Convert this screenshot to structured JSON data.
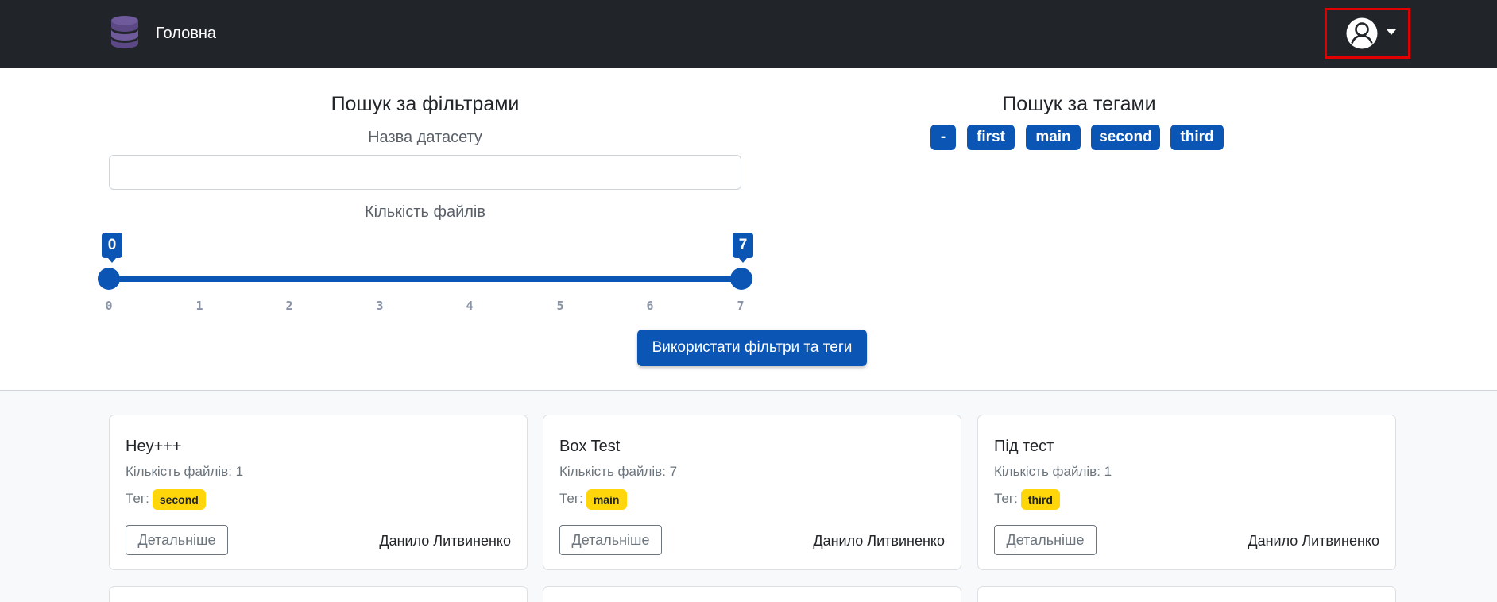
{
  "navbar": {
    "brand": "Головна",
    "logo_icon": "database-icon",
    "user_icon": "user-circle-icon"
  },
  "filters": {
    "title": "Пошук за фільтрами",
    "name_label": "Назва датасету",
    "name_value": "",
    "count_label": "Кількість файлів",
    "slider": {
      "min": 0,
      "max": 7,
      "low": 0,
      "high": 7,
      "low_label": "0",
      "high_label": "7",
      "ticks": [
        "0",
        "1",
        "2",
        "3",
        "4",
        "5",
        "6",
        "7"
      ]
    },
    "apply_label": "Використати фільтри та теги"
  },
  "tags": {
    "title": "Пошук за тегами",
    "items": [
      "-",
      "first",
      "main",
      "second",
      "third"
    ]
  },
  "datasets": [
    {
      "title": "Hey+++",
      "count": "Кількість файлів: 1",
      "tag_label": "Тег:",
      "tag": "second",
      "details": "Детальніше",
      "author": "Данило Литвиненко"
    },
    {
      "title": "Box Test",
      "count": "Кількість файлів: 7",
      "tag_label": "Тег:",
      "tag": "main",
      "details": "Детальніше",
      "author": "Данило Литвиненко"
    },
    {
      "title": "Під тест",
      "count": "Кількість файлів: 1",
      "tag_label": "Тег:",
      "tag": "third",
      "details": "Детальніше",
      "author": "Данило Литвиненко"
    }
  ],
  "colors": {
    "navbar": "#212529",
    "primary": "#0b56b5",
    "tag_badge": "#ffd60a",
    "highlight": "#e00000"
  }
}
